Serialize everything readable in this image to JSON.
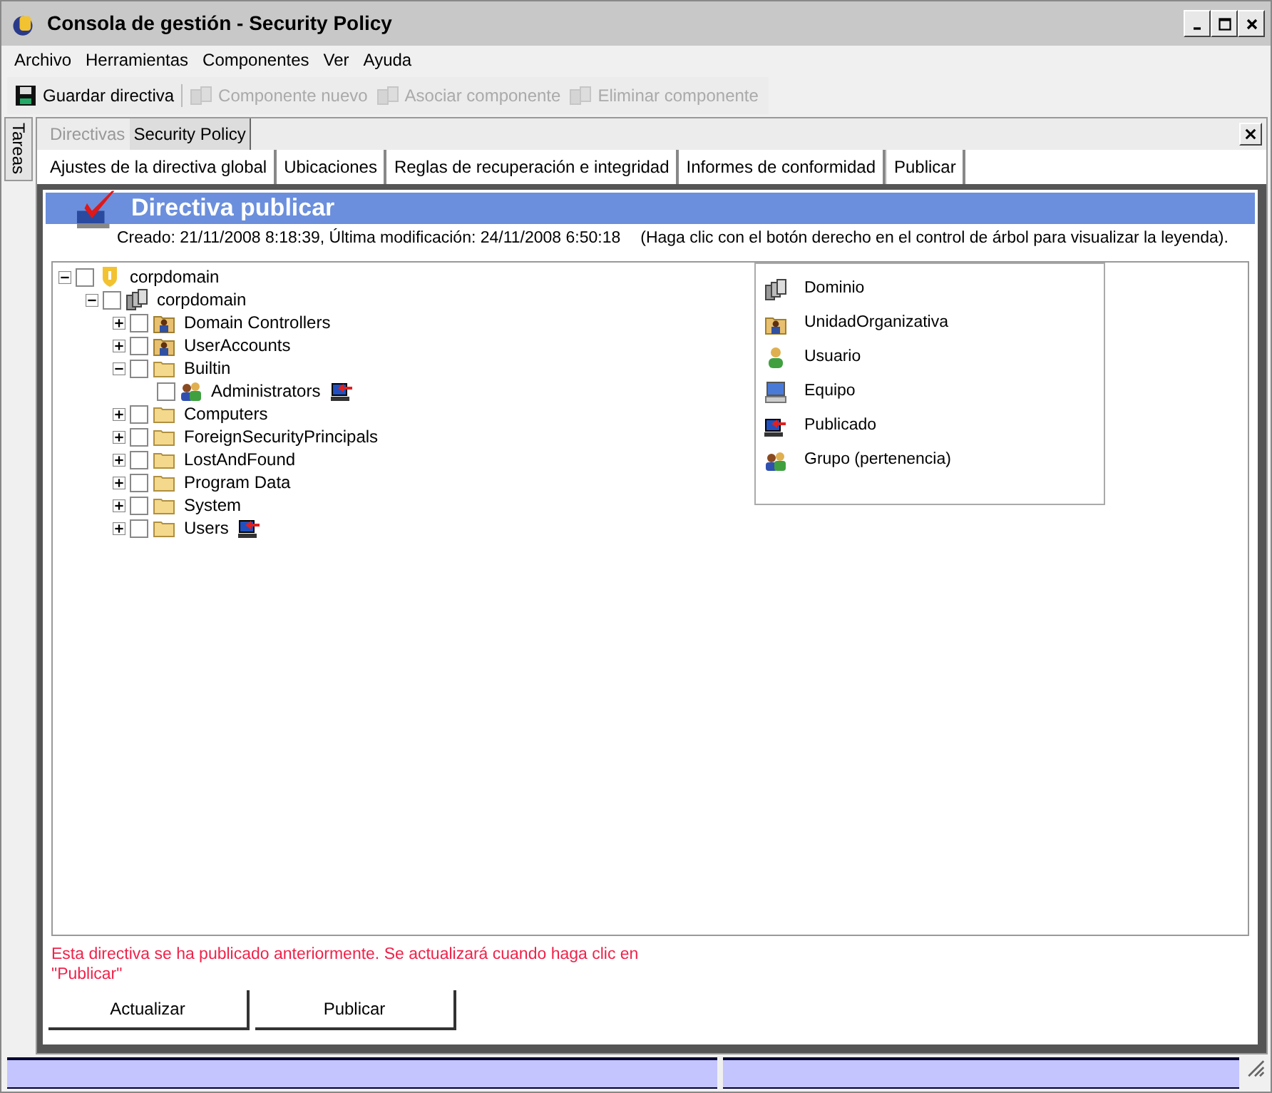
{
  "window": {
    "title": "Consola de gestión - Security Policy"
  },
  "menu": [
    "Archivo",
    "Herramientas",
    "Componentes",
    "Ver",
    "Ayuda"
  ],
  "toolbar": [
    {
      "label": "Guardar directiva",
      "kind": "save",
      "disabled": false
    },
    {
      "label": "Componente nuevo",
      "kind": "component",
      "disabled": true
    },
    {
      "label": "Asociar componente",
      "kind": "component",
      "disabled": true
    },
    {
      "label": "Eliminar componente",
      "kind": "component",
      "disabled": true
    }
  ],
  "side_panel": {
    "label": "Tareas"
  },
  "document_tabs": [
    {
      "label": "Directivas",
      "selected": false
    },
    {
      "label": "Security Policy",
      "selected": true
    }
  ],
  "page_tabs": [
    {
      "label": "Ajustes de la directiva global",
      "selected": false
    },
    {
      "label": "Ubicaciones",
      "selected": false
    },
    {
      "label": "Reglas de recuperación e integridad",
      "selected": false
    },
    {
      "label": "Informes de conformidad",
      "selected": false
    },
    {
      "label": "Publicar",
      "selected": true
    }
  ],
  "header": {
    "title": "Directiva publicar",
    "created": "Creado: 21/11/2008 8:18:39, Última modificación: 24/11/2008 6:50:18",
    "hint": "(Haga clic con el botón derecho en el control de árbol para visualizar la leyenda)."
  },
  "tree": [
    {
      "label": "corpdomain",
      "kind": "shield",
      "checked": false,
      "expanded": true,
      "published": false,
      "children": [
        {
          "label": "corpdomain",
          "kind": "domain",
          "checked": false,
          "expanded": true,
          "published": false,
          "children": [
            {
              "label": "Domain Controllers",
              "kind": "ou",
              "checked": false,
              "expanded": false,
              "published": false
            },
            {
              "label": "UserAccounts",
              "kind": "ou",
              "checked": false,
              "expanded": false,
              "published": false
            },
            {
              "label": "Builtin",
              "kind": "folder",
              "checked": false,
              "expanded": true,
              "published": false,
              "children": [
                {
                  "label": "Administrators",
                  "kind": "group",
                  "checked": false,
                  "published": true
                }
              ]
            },
            {
              "label": "Computers",
              "kind": "folder",
              "checked": false,
              "expanded": false,
              "published": false
            },
            {
              "label": "ForeignSecurityPrincipals",
              "kind": "folder",
              "checked": false,
              "expanded": false,
              "published": false
            },
            {
              "label": "LostAndFound",
              "kind": "folder",
              "checked": false,
              "expanded": false,
              "published": false
            },
            {
              "label": "Program Data",
              "kind": "folder",
              "checked": false,
              "expanded": false,
              "published": false
            },
            {
              "label": "System",
              "kind": "folder",
              "checked": false,
              "expanded": false,
              "published": false
            },
            {
              "label": "Users",
              "kind": "folder",
              "checked": false,
              "expanded": false,
              "published": true
            }
          ]
        }
      ]
    }
  ],
  "legend": [
    {
      "label": "Dominio",
      "kind": "domain"
    },
    {
      "label": "UnidadOrganizativa",
      "kind": "ou"
    },
    {
      "label": "Usuario",
      "kind": "user"
    },
    {
      "label": "Equipo",
      "kind": "computer"
    },
    {
      "label": "Publicado",
      "kind": "published"
    },
    {
      "label": "Grupo (pertenencia)",
      "kind": "group"
    }
  ],
  "notice": "Esta directiva se ha publicado anteriormente. Se actualizará cuando haga clic en \"Publicar\"",
  "buttons": [
    "Actualizar",
    "Publicar"
  ]
}
